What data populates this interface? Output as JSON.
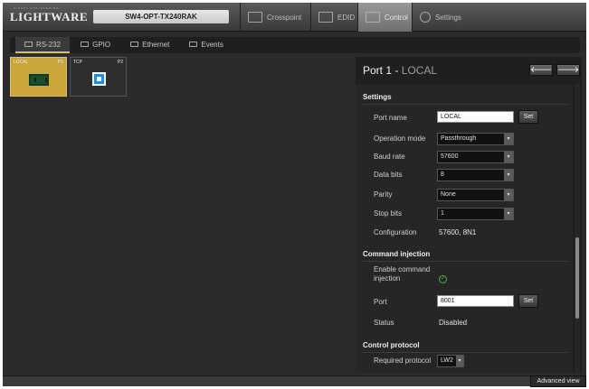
{
  "header": {
    "logo": "LIGHTWARE",
    "logo_sub": "VISUAL ENGINEERING",
    "device_name": "SW4-OPT-TX240RAK",
    "tabs": [
      {
        "label": "Crosspoint",
        "icon": "crosspoint-icon"
      },
      {
        "label": "EDID",
        "icon": "monitor-icon"
      },
      {
        "label": "Control",
        "icon": "control-icon",
        "active": true
      },
      {
        "label": "Settings",
        "icon": "gears-icon"
      }
    ]
  },
  "subtabs": [
    {
      "label": "RS-232",
      "icon": "rs232-icon",
      "active": true
    },
    {
      "label": "GPIO",
      "icon": "gpio-icon"
    },
    {
      "label": "Ethernet",
      "icon": "ethernet-icon"
    },
    {
      "label": "Events",
      "icon": "events-icon"
    }
  ],
  "ports": [
    {
      "label": "LOCAL",
      "num": "P1",
      "icon": "rs232-port-icon",
      "selected": true
    },
    {
      "label": "TCP",
      "num": "P2",
      "icon": "tcp-port-icon",
      "selected": false
    }
  ],
  "panel": {
    "title": "Port 1",
    "separator": " - ",
    "subtitle": "LOCAL",
    "prev": "🡐",
    "next": "🡒",
    "settings_title": "Settings",
    "port_name_label": "Port name",
    "port_name_value": "LOCAL",
    "set_label": "Set",
    "operation_mode_label": "Operation mode",
    "operation_mode_value": "Passthrough",
    "baud_rate_label": "Baud rate",
    "baud_rate_value": "57600",
    "data_bits_label": "Data bits",
    "data_bits_value": "8",
    "parity_label": "Parity",
    "parity_value": "None",
    "stop_bits_label": "Stop bits",
    "stop_bits_value": "1",
    "configuration_label": "Configuration",
    "configuration_value": "57600, 8N1",
    "command_injection_title": "Command injection",
    "enable_ci_label_1": "Enable command",
    "enable_ci_label_2": "injection",
    "ci_port_label": "Port",
    "ci_port_value": "8001",
    "ci_set_label": "Set",
    "status_label": "Status",
    "status_value": "Disabled",
    "control_protocol_title": "Control protocol",
    "required_protocol_label": "Required protocol",
    "required_protocol_value": "LW2"
  },
  "footer": {
    "advanced_view": "Advanced view"
  },
  "colors": {
    "accent": "#c9a53a",
    "checkbox": "#4bb04b"
  }
}
